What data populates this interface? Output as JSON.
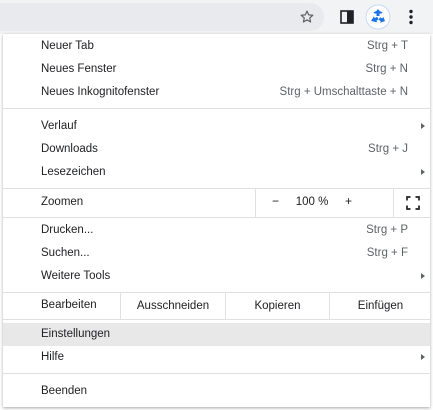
{
  "toolbar": {
    "icons": [
      "star-icon",
      "side-panel-icon",
      "profile-avatar-icon",
      "menu-dots-icon"
    ]
  },
  "menu": {
    "group1": [
      {
        "label": "Neuer Tab",
        "shortcut": "Strg + T"
      },
      {
        "label": "Neues Fenster",
        "shortcut": "Strg + N"
      },
      {
        "label": "Neues Inkognitofenster",
        "shortcut": "Strg + Umschalttaste + N"
      }
    ],
    "group2": [
      {
        "label": "Verlauf",
        "submenu": true
      },
      {
        "label": "Downloads",
        "shortcut": "Strg + J"
      },
      {
        "label": "Lesezeichen",
        "submenu": true
      }
    ],
    "zoom": {
      "label": "Zoomen",
      "minus": "−",
      "value": "100 %",
      "plus": "+"
    },
    "group3": [
      {
        "label": "Drucken...",
        "shortcut": "Strg + P"
      },
      {
        "label": "Suchen...",
        "shortcut": "Strg + F"
      },
      {
        "label": "Weitere Tools",
        "submenu": true
      }
    ],
    "edit": {
      "label": "Bearbeiten",
      "cut": "Ausschneiden",
      "copy": "Kopieren",
      "paste": "Einfügen"
    },
    "group4": [
      {
        "label": "Einstellungen",
        "highlighted": true
      },
      {
        "label": "Hilfe",
        "submenu": true
      }
    ],
    "exit": {
      "label": "Beenden"
    }
  },
  "colors": {
    "toolbar_bg": "#f1f3f4",
    "highlight_bg": "#e8e8e8",
    "avatar_blue": "#1a73e8",
    "text": "#202124",
    "secondary_text": "#5f6368"
  }
}
